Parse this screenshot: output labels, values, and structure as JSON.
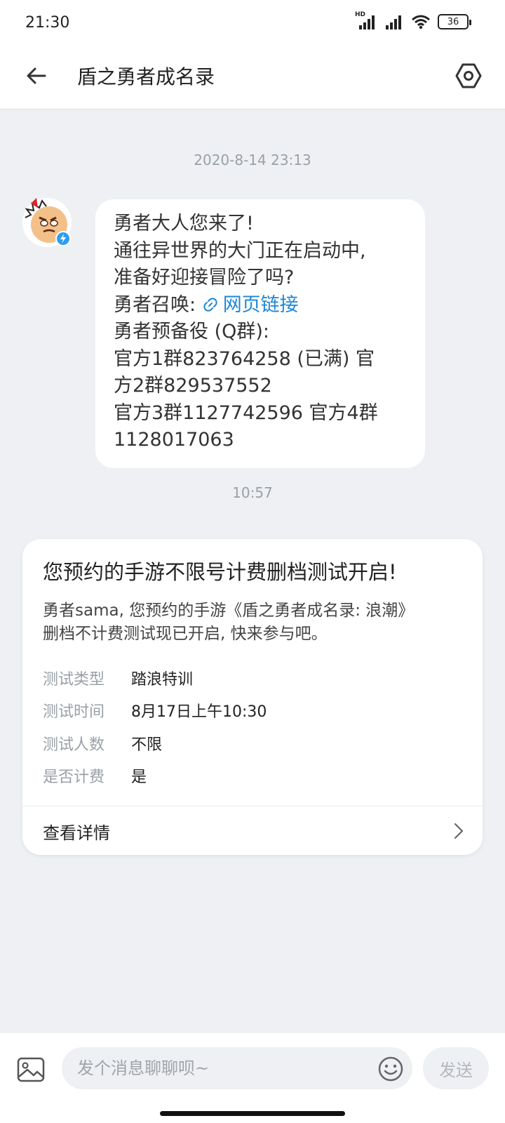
{
  "status_bar": {
    "time": "21:30",
    "network_label": "HD",
    "battery_level": "36"
  },
  "header": {
    "title": "盾之勇者成名录",
    "back_icon": "arrow-left-icon",
    "settings_icon": "hexagon-settings-icon"
  },
  "chat": {
    "timestamp_1": "2020-8-14 23:13",
    "message_1": {
      "line_1": "勇者大人您来了!",
      "line_2": "通往异世界的大门正在启动中,",
      "line_3": "准备好迎接冒险了吗?",
      "line_4_prefix": "勇者召唤: ",
      "link_text": "网页链接",
      "line_5": "勇者预备役 (Q群):",
      "line_6": "官方1群823764258 (已满) 官",
      "line_7": "方2群829537552",
      "line_8": "官方3群1127742596 官方4群",
      "line_9": "1128017063"
    },
    "timestamp_2": "10:57",
    "card": {
      "title": "您预约的手游不限号计费删档测试开启!",
      "description_line_1": "勇者sama, 您预约的手游《盾之勇者成名录: 浪潮》",
      "description_line_2": "删档不计费测试现已开启, 快来参与吧。",
      "rows": [
        {
          "key": "测试类型",
          "value": "踏浪特训"
        },
        {
          "key": "测试时间",
          "value": "8月17日上午10:30"
        },
        {
          "key": "测试人数",
          "value": "不限"
        },
        {
          "key": "是否计费",
          "value": "是"
        }
      ],
      "footer_label": "查看详情"
    }
  },
  "input_bar": {
    "placeholder": "发个消息聊聊呗~",
    "send_label": "发送"
  },
  "colors": {
    "background": "#eef0f3",
    "link": "#1d87d6",
    "muted": "#9aa0a8"
  }
}
